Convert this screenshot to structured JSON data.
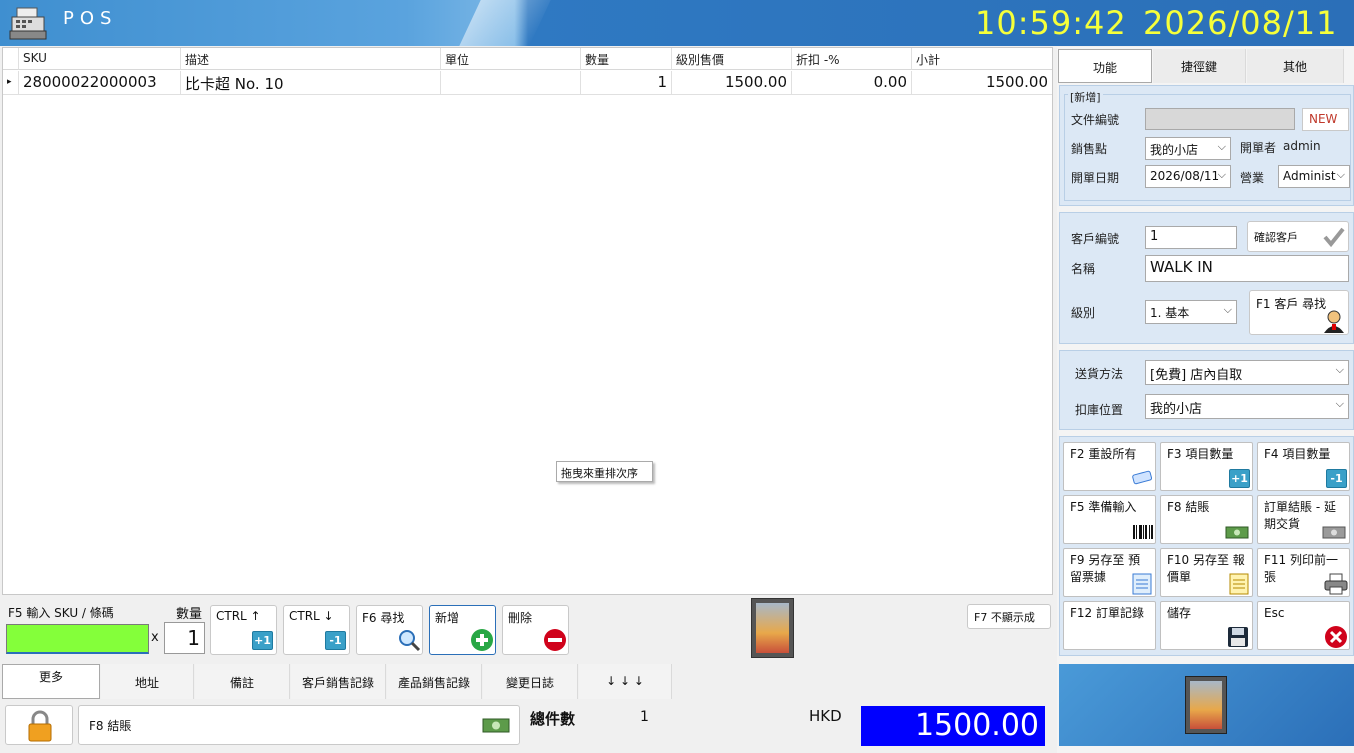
{
  "header": {
    "title": "POS",
    "time": "10:59:42",
    "date": "2026/08/11"
  },
  "grid": {
    "columns": [
      "SKU",
      "描述",
      "單位",
      "數量",
      "級別售價",
      "折扣 -%",
      "小計"
    ],
    "rows": [
      {
        "sku": "28000022000003",
        "desc": "比卡超 No. 10",
        "unit": "",
        "qty": "1",
        "price": "1500.00",
        "discount": "0.00",
        "subtotal": "1500.00"
      }
    ],
    "drag_hint": "拖曳來重排次序"
  },
  "entry": {
    "sku_label": "F5 輸入 SKU / 條碼",
    "sku_value": "",
    "qty_label": "數量",
    "times": "x",
    "qty_value": "1"
  },
  "actions": {
    "ctrl_up": "CTRL ↑",
    "ctrl_down": "CTRL ↓",
    "find": "F6 尋找",
    "add": "新增",
    "delete": "刪除",
    "plus1": "+1",
    "minus1": "-1",
    "hide_display": "F7 不顯示成"
  },
  "bottom_tabs": [
    "更多",
    "地址",
    "備註",
    "客戶銷售記錄",
    "產品銷售記錄",
    "變更日誌",
    "↓ ↓ ↓"
  ],
  "footer": {
    "checkout": "F8 結賬",
    "total_items_label": "總件數",
    "total_items": "1",
    "currency": "HKD",
    "total": "1500.00"
  },
  "right_tabs": [
    "功能",
    "捷徑鍵",
    "其他"
  ],
  "doc": {
    "legend": "[新增]",
    "doc_no_label": "文件編號",
    "new_btn": "NEW",
    "store_label": "銷售點",
    "store_value": "我的小店",
    "opener_label": "開單者",
    "opener_value": "admin",
    "date_label": "開單日期",
    "date_value": "2026/08/11",
    "sales_label": "營業",
    "sales_value": "Administ"
  },
  "customer": {
    "no_label": "客戶編號",
    "no_value": "1",
    "confirm_btn": "確認客戶",
    "name_label": "名稱",
    "name_value": "WALK IN",
    "level_label": "級別",
    "level_value": "1. 基本",
    "find_btn": "F1 客戶 尋找"
  },
  "delivery": {
    "method_label": "送貨方法",
    "method_value": "[免費] 店內自取",
    "stock_label": "扣庫位置",
    "stock_value": "我的小店"
  },
  "fkeys": [
    {
      "label": "F2 重設所有"
    },
    {
      "label": "F3 項目數量"
    },
    {
      "label": "F4 項目數量"
    },
    {
      "label": "F5 準備輸入"
    },
    {
      "label": "F8 結賬"
    },
    {
      "label": "訂單結賬 - 延期交貨"
    },
    {
      "label": "F9 另存至 預留票據"
    },
    {
      "label": "F10 另存至 報價單"
    },
    {
      "label": "F11 列印前一張"
    },
    {
      "label": "F12 訂單記錄"
    },
    {
      "label": "儲存"
    },
    {
      "label": "Esc"
    }
  ],
  "colors": {
    "accent": "#2b6fb8",
    "clock": "#f6ff3a",
    "sku_input": "#84ff3a",
    "total_bg": "#0000ff",
    "new_btn": "#c0392b"
  }
}
